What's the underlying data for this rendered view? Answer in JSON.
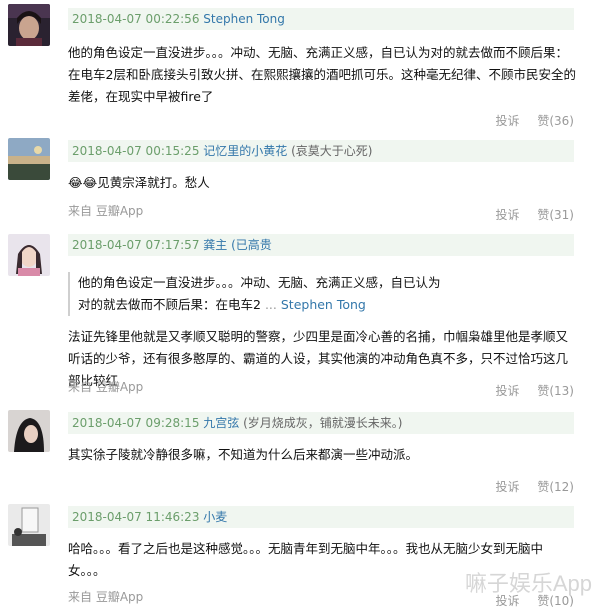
{
  "comments": [
    {
      "time": "2018-04-07 00:22:56",
      "user": "Stephen Tong",
      "signature": "",
      "text": "他的角色设定一直没进步。。。冲动、无脑、充满正义感，自已认为对的就去做而不顾后果：在电车2层和卧底接头引致火拼、在熙熙攘攘的酒吧抓可乐。这种毫无纪律、不顾市民安全的差佬，在现实中早被fire了",
      "via": "",
      "report": "投诉",
      "like": "赞(36)"
    },
    {
      "time": "2018-04-07 00:15:25",
      "user": "记忆里的小黄花",
      "signature": "(哀莫大于心死)",
      "text": "😂😂见黄宗泽就打。愁人",
      "via": "来自 豆瓣App",
      "report": "投诉",
      "like": "赞(31)"
    },
    {
      "time": "2018-04-07 07:17:57",
      "user": "龚主",
      "signature": "(已高贵",
      "quote_text": "他的角色设定一直没进步。。。冲动、无脑、充满正义感，自已认为对的就去做而不顾后果：在电车2",
      "quote_more": "...",
      "quote_author": "Stephen Tong",
      "text": "法证先锋里他就是又孝顺又聪明的警察，少四里是面冷心善的名捕，巾帼枭雄里他是孝顺又听话的少爷，还有很多憨厚的、霸道的人设，其实他演的冲动角色真不多，只不过恰巧这几部比较红",
      "via": "来自 豆瓣App",
      "report": "投诉",
      "like": "赞(13)"
    },
    {
      "time": "2018-04-07 09:28:15",
      "user": "九宫弦",
      "signature": "(岁月烧成灰，铺就漫长未来。)",
      "text": "其实徐子陵就冷静很多嘛，不知道为什么后来都演一些冲动派。",
      "via": "",
      "report": "投诉",
      "like": "赞(12)"
    },
    {
      "time": "2018-04-07 11:46:23",
      "user": "小麦",
      "signature": "",
      "text": "哈哈。。。看了之后也是这种感觉。。。无脑青年到无脑中年。。。我也从无脑少女到无脑中女。。。",
      "via": "来自 豆瓣App",
      "report": "投诉",
      "like": "赞(10)"
    }
  ],
  "watermark": "嘛子娱乐App"
}
